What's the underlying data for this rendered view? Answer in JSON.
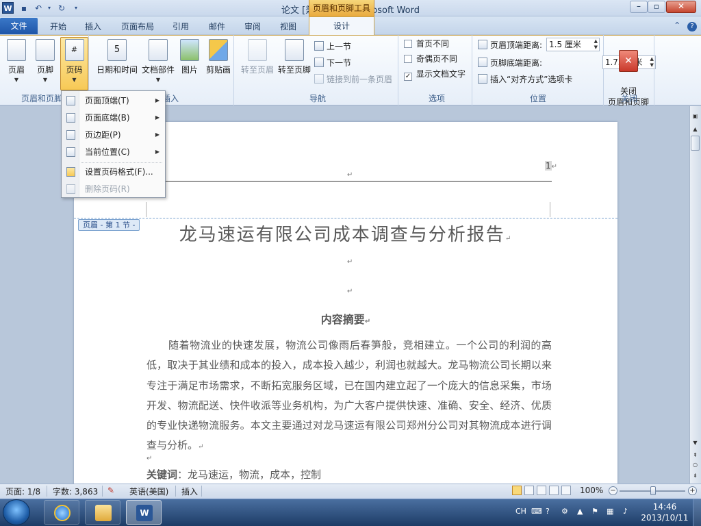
{
  "window": {
    "title": "论文 [兼容模式] - Microsoft Word",
    "context_tab": "页眉和页脚工具",
    "app_icon": "W"
  },
  "colors": {
    "accent": "#2b5797",
    "context": "#f7c956",
    "file_tab": "#1e55a8"
  },
  "tabs": {
    "file": "文件",
    "items": [
      "开始",
      "插入",
      "页面布局",
      "引用",
      "邮件",
      "审阅",
      "视图"
    ],
    "design": "设计"
  },
  "ribbon": {
    "header_footer": {
      "header": "页眉",
      "footer": "页脚",
      "page_number": "页码",
      "label": "页眉和页脚"
    },
    "insert": {
      "datetime": "日期和时间",
      "quickparts": "文档部件",
      "picture": "图片",
      "clipart": "剪贴画",
      "label": "插入"
    },
    "navigation": {
      "goto_header": "转至页眉",
      "goto_footer": "转至页脚",
      "previous": "上一节",
      "next": "下一节",
      "link_previous": "链接到前一条页眉",
      "label": "导航"
    },
    "options": {
      "first_page": "首页不同",
      "odd_even": "奇偶页不同",
      "show_text": "显示文档文字",
      "show_text_checked": "✓",
      "label": "选项"
    },
    "position": {
      "header_top": "页眉顶端距离:",
      "header_value": "1.5 厘米",
      "footer_bottom": "页脚底端距离:",
      "footer_value": "1.75 厘米",
      "insert_align": "插入“对齐方式”选项卡",
      "label": "位置"
    },
    "close": {
      "button": "关闭\n页眉和页脚",
      "label": "关闭"
    }
  },
  "menu": {
    "items": [
      {
        "label": "页面顶端(T)"
      },
      {
        "label": "页面底端(B)"
      },
      {
        "label": "页边距(P)"
      },
      {
        "label": "当前位置(C)"
      },
      {
        "label": "设置页码格式(F)..."
      },
      {
        "label": "删除页码(R)"
      }
    ]
  },
  "document": {
    "page_number": "1",
    "para_mark": "↵",
    "header_label": "页眉 - 第 1 节 -",
    "title": "龙马速运有限公司成本调查与分析报告",
    "abstract_heading": "内容摘要",
    "abstract": "随着物流业的快速发展，物流公司像雨后春笋般，竞相建立。一个公司的利润的高低，取决于其业绩和成本的投入，成本投入越少，利润也就越大。龙马物流公司长期以来专注于满足市场需求，不断拓宽服务区域，已在国内建立起了一个庞大的信息采集，市场开发、物流配送、快件收派等业务机构，为广大客户提供快速、准确、安全、经济、优质的专业快递物流服务。本文主要通过对龙马速运有限公司郑州分公司对其物流成本进行调查与分析。",
    "keywords_label": "关键词",
    "keywords": "：龙马速运，物流，成本，控制"
  },
  "status": {
    "page": "页面: 1/8",
    "words": "字数: 3,863",
    "language": "英语(美国)",
    "mode": "插入",
    "zoom": "100%",
    "zoom_minus": "−",
    "zoom_plus": "+"
  },
  "taskbar": {
    "time": "14:46",
    "date": "2013/10/11",
    "ime": "CH"
  }
}
